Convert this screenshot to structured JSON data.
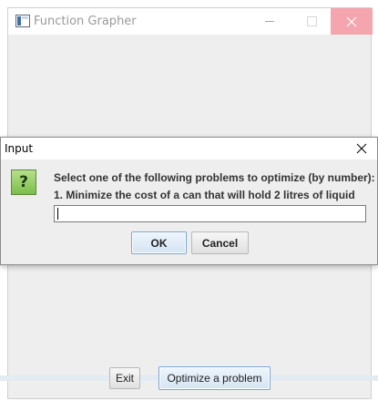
{
  "main_window": {
    "title": "Function Grapher",
    "icon": "window-app-icon",
    "buttons": {
      "exit": "Exit",
      "optimize": "Optimize a problem"
    }
  },
  "dialog": {
    "title": "Input",
    "icon": "question-icon",
    "icon_glyph": "?",
    "message_line1": "Select one of the following problems to optimize (by number):",
    "message_line2": "1. Minimize the cost of a can that will hold 2 litres of liquid",
    "input_value": "",
    "buttons": {
      "ok": "OK",
      "cancel": "Cancel"
    }
  },
  "colors": {
    "close_hover": "#f4a5ad",
    "focused_button_border": "#7aa7cf",
    "question_icon_green": "#7bbd4a",
    "window_background": "#eeeeee"
  }
}
